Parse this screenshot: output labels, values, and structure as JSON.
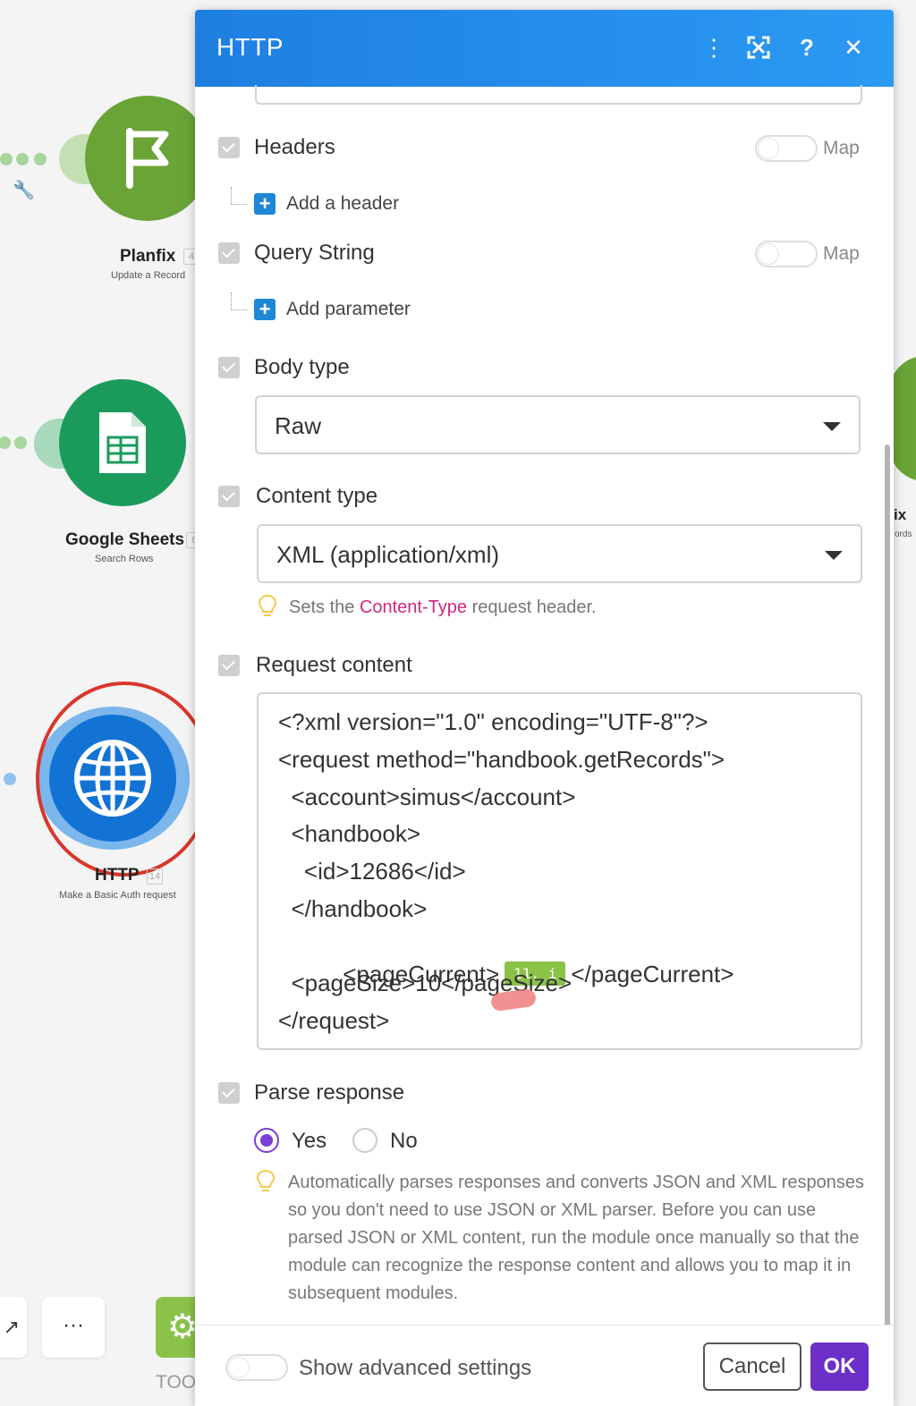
{
  "canvas": {
    "nodes": [
      {
        "name": "Planfix",
        "subtitle": "Update a Record",
        "badge": "4",
        "color": "#6aa336",
        "icon": "flag-icon"
      },
      {
        "name": "Google Sheets",
        "subtitle": "Search Rows",
        "badge": "6",
        "color": "#1a9b5c",
        "icon": "sheet-icon"
      },
      {
        "name": "HTTP",
        "subtitle": "Make a Basic Auth request",
        "badge": "14",
        "color": "#1273d4",
        "icon": "globe-icon"
      }
    ],
    "right_node_fragment": {
      "name": "ix",
      "subtitle": "ords"
    },
    "bottom_bar": {
      "more_label": "···",
      "tools_label": "TOO"
    }
  },
  "modal": {
    "title": "HTTP",
    "header_icons": [
      "more-vertical-icon",
      "expand-icon",
      "help-icon",
      "close-icon"
    ],
    "headers": {
      "label": "Headers",
      "map_label": "Map",
      "add_label": "Add a header"
    },
    "query_string": {
      "label": "Query String",
      "map_label": "Map",
      "add_label": "Add parameter"
    },
    "body_type": {
      "label": "Body type",
      "value": "Raw"
    },
    "content_type": {
      "label": "Content type",
      "value": "XML (application/xml)",
      "hint_prefix": "Sets the ",
      "hint_highlight": "Content-Type",
      "hint_suffix": " request header."
    },
    "request_content": {
      "label": "Request content",
      "lines": [
        "<?xml version=\"1.0\" encoding=\"UTF-8\"?>",
        "<request method=\"handbook.getRecords\">",
        "  <account>simus</account>",
        "  <handbook>",
        "    <id>12686</id>",
        "  </handbook>"
      ],
      "page_current_open": "  <pageCurrent>",
      "page_current_pill": "11. i",
      "page_current_close": "</pageCurrent>",
      "page_size_line": "  <pageSize>10</pageSize>",
      "end_line": "</request>"
    },
    "parse_response": {
      "label": "Parse response",
      "yes_label": "Yes",
      "no_label": "No",
      "selected": "Yes",
      "hint": "Automatically parses responses and converts JSON and XML responses so you don't need to use JSON or XML parser. Before you can use parsed JSON or XML content, run the module once manually so that the module can recognize the response content and allows you to map it in subsequent modules."
    },
    "footer": {
      "advanced_label": "Show advanced settings",
      "cancel_label": "Cancel",
      "ok_label": "OK"
    }
  },
  "colors": {
    "header_blue": "#2b8ff0",
    "ok_purple": "#6c2fc7",
    "radio_purple": "#7a3fd6",
    "annotation_red": "#d9362b"
  }
}
